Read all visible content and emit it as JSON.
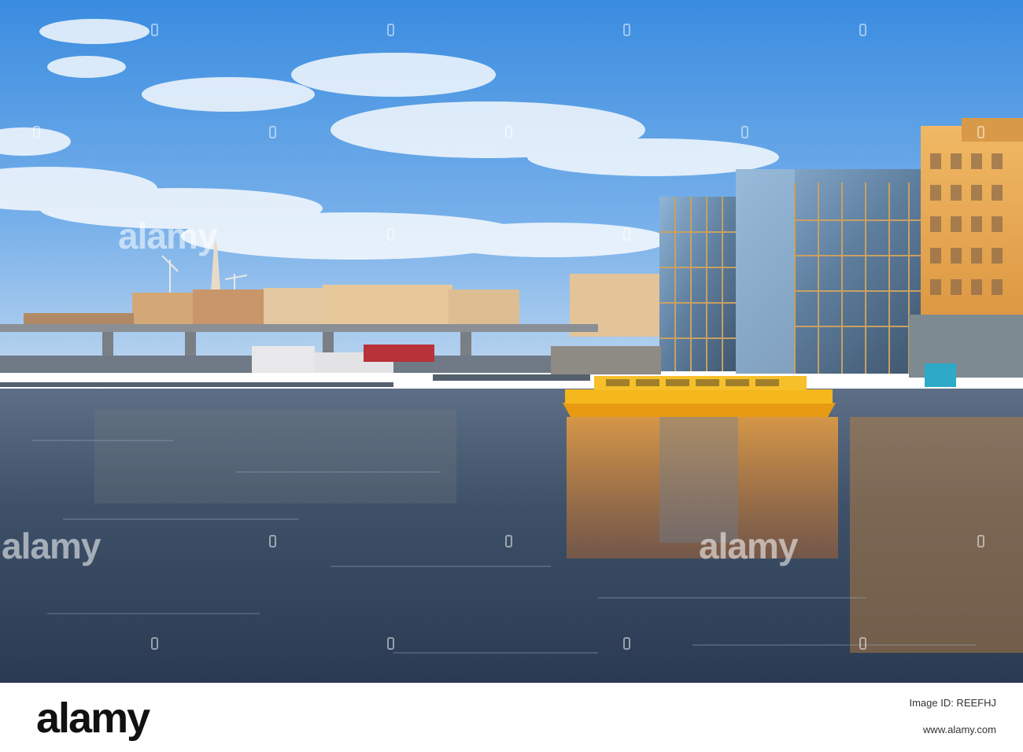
{
  "watermark": {
    "text": "alamy"
  },
  "footer": {
    "logo": "alamy",
    "image_id_label": "Image ID: REEFHJ",
    "url": "www.alamy.com"
  },
  "colors": {
    "sky_top": "#3f8fe0",
    "sky_bottom": "#9cc6ee",
    "water": "#3b4e66",
    "boat": "#f2b21a",
    "building_gold": "#e9a850"
  }
}
